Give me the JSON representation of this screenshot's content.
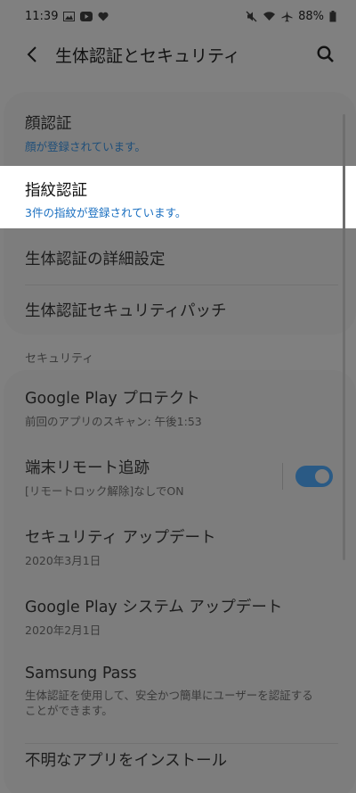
{
  "status_bar": {
    "time": "11:39",
    "left_icons": [
      "image-icon",
      "youtube-icon",
      "heart-icon"
    ],
    "right_icons": [
      "mute-icon",
      "wifi-icon",
      "airplane-icon"
    ],
    "battery": "88%"
  },
  "appbar": {
    "title": "生体認証とセキュリティ"
  },
  "biometrics": [
    {
      "title": "顔認証",
      "subtitle": "顔が登録されています。"
    },
    {
      "title": "指紋認証",
      "subtitle": "3件の指紋が登録されています。"
    },
    {
      "title": "生体認証の詳細設定"
    },
    {
      "title": "生体認証セキュリティパッチ"
    }
  ],
  "security_section": {
    "label": "セキュリティ",
    "items": [
      {
        "title": "Google Play プロテクト",
        "subtitle": "前回のアプリのスキャン: 午後1:53"
      },
      {
        "title": "端末リモート追跡",
        "subtitle": "[リモートロック解除]なしでON",
        "toggle": "on"
      },
      {
        "title": "セキュリティ アップデート",
        "subtitle": "2020年3月1日"
      },
      {
        "title": "Google Play システム アップデート",
        "subtitle": "2020年2月1日"
      },
      {
        "title": "Samsung Pass",
        "subtitle": "生体認証を使用して、安全かつ簡単にユーザーを認証することができます。"
      },
      {
        "title": "不明なアプリをインストール"
      }
    ]
  },
  "colors": {
    "dim_overlay_bg": "#808080",
    "highlight_bg": "#ffffff",
    "accent_blue": "#1a6fc0",
    "toggle_on": "#2a5a85"
  }
}
